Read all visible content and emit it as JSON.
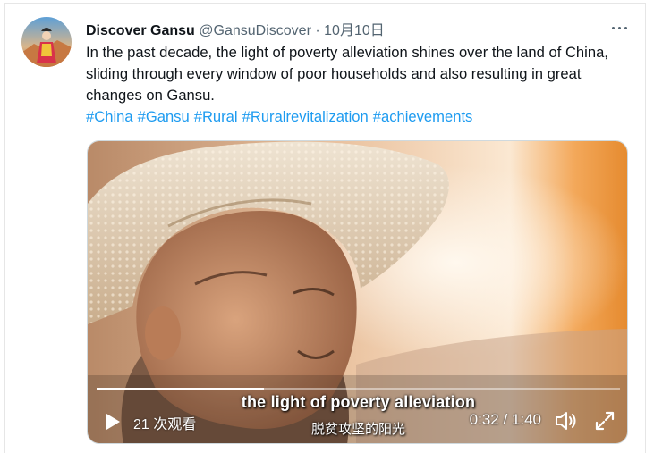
{
  "tweet": {
    "display_name": "Discover Gansu",
    "handle": "@GansuDiscover",
    "separator": "·",
    "date": "10月10日",
    "text": "In the past decade, the light of poverty alleviation shines over the land of China, sliding through every window of poor households and also resulting in great changes on Gansu.",
    "hashtags": [
      "#China",
      "#Gansu",
      "#Rural",
      "#Ruralrevitalization",
      "#achievements"
    ]
  },
  "icons": {
    "more": "more-horizontal-icon",
    "play": "play-icon",
    "volume": "volume-icon",
    "fullscreen": "fullscreen-icon"
  },
  "video": {
    "views": "21 次观看",
    "current_time": "0:32",
    "time_separator": " / ",
    "duration": "1:40",
    "progress_fraction": 0.32,
    "subtitle_en": "the light of poverty alleviation",
    "subtitle_zh": "脱贫攻坚的阳光"
  },
  "colors": {
    "link": "#1d9bf0",
    "text": "#0f1419",
    "secondary": "#536471"
  }
}
